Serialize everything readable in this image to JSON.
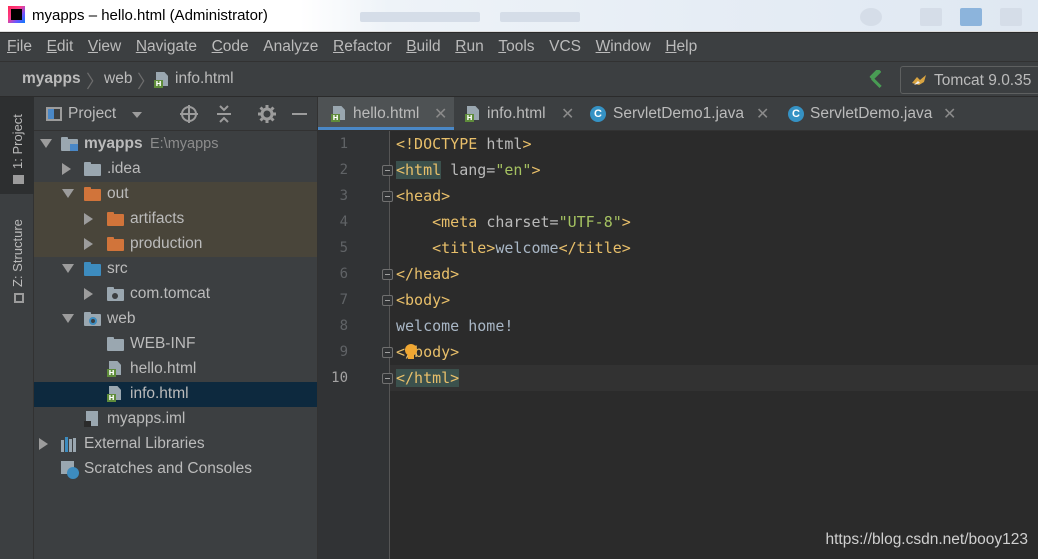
{
  "window": {
    "title": "myapps – hello.html (Administrator)"
  },
  "menu": [
    {
      "label": "File",
      "mnemonic": "F",
      "rest": "ile"
    },
    {
      "label": "Edit",
      "mnemonic": "E",
      "rest": "dit"
    },
    {
      "label": "View",
      "mnemonic": "V",
      "rest": "iew"
    },
    {
      "label": "Navigate",
      "mnemonic": "N",
      "rest": "avigate"
    },
    {
      "label": "Code",
      "mnemonic": "C",
      "rest": "ode"
    },
    {
      "label": "Analyze",
      "mnemonic": "",
      "rest": "Analyze"
    },
    {
      "label": "Refactor",
      "mnemonic": "R",
      "rest": "efactor"
    },
    {
      "label": "Build",
      "mnemonic": "B",
      "rest": "uild"
    },
    {
      "label": "Run",
      "mnemonic": "R",
      "rest": "un"
    },
    {
      "label": "Tools",
      "mnemonic": "T",
      "rest": "ools"
    },
    {
      "label": "VCS",
      "mnemonic": "",
      "rest": "VCS"
    },
    {
      "label": "Window",
      "mnemonic": "W",
      "rest": "indow"
    },
    {
      "label": "Help",
      "mnemonic": "H",
      "rest": "elp"
    }
  ],
  "breadcrumb": {
    "project": "myapps",
    "folder": "web",
    "file": "info.html"
  },
  "run_config": {
    "label": "Tomcat 9.0.35"
  },
  "side_tabs": {
    "project": "1: Project",
    "structure": "Z: Structure"
  },
  "project_panel": {
    "title": "Project",
    "tree": [
      {
        "label": "myapps",
        "path": "E:\\myapps",
        "icon": "module-folder-icon",
        "expanded": true
      },
      {
        "label": ".idea",
        "icon": "folder-icon",
        "expanded": false
      },
      {
        "label": "out",
        "icon": "excluded-folder-icon",
        "expanded": true
      },
      {
        "label": "artifacts",
        "icon": "excluded-folder-icon",
        "expanded": false
      },
      {
        "label": "production",
        "icon": "excluded-folder-icon",
        "expanded": false
      },
      {
        "label": "src",
        "icon": "source-folder-icon",
        "expanded": true
      },
      {
        "label": "com.tomcat",
        "icon": "package-folder-icon",
        "expanded": false
      },
      {
        "label": "web",
        "icon": "web-folder-icon",
        "expanded": true
      },
      {
        "label": "WEB-INF",
        "icon": "folder-icon"
      },
      {
        "label": "hello.html",
        "icon": "html-file-icon"
      },
      {
        "label": "info.html",
        "icon": "html-file-icon",
        "selected": true
      },
      {
        "label": "myapps.iml",
        "icon": "iml-file-icon"
      },
      {
        "label": "External Libraries",
        "icon": "libraries-icon",
        "expanded": false
      },
      {
        "label": "Scratches and Consoles",
        "icon": "scratches-icon"
      }
    ]
  },
  "tabs": [
    {
      "label": "hello.html",
      "icon": "html-file-icon",
      "active": true
    },
    {
      "label": "info.html",
      "icon": "html-file-icon",
      "active": false
    },
    {
      "label": "ServletDemo1.java",
      "icon": "class-icon",
      "active": false
    },
    {
      "label": "ServletDemo.java",
      "icon": "class-icon",
      "active": false
    }
  ],
  "editor": {
    "current_line": 10,
    "lines": [
      {
        "n": "1",
        "tokens": [
          [
            "t-tag",
            "<!DOCTYPE "
          ],
          [
            "t-attr",
            "html"
          ],
          [
            "t-tag",
            ">"
          ]
        ]
      },
      {
        "n": "2",
        "tokens": [
          [
            "t-tag",
            "<html "
          ],
          [
            "t-attr",
            "lang="
          ],
          [
            "t-val",
            "\"en\""
          ],
          [
            "t-tag",
            ">"
          ]
        ]
      },
      {
        "n": "3",
        "tokens": [
          [
            "t-tag",
            "<head>"
          ]
        ]
      },
      {
        "n": "4",
        "tokens": [
          [
            "t-text",
            "    "
          ],
          [
            "t-tag",
            "<meta "
          ],
          [
            "t-attr",
            "charset="
          ],
          [
            "t-val",
            "\"UTF-8\""
          ],
          [
            "t-tag",
            ">"
          ]
        ]
      },
      {
        "n": "5",
        "tokens": [
          [
            "t-text",
            "    "
          ],
          [
            "t-tag",
            "<title>"
          ],
          [
            "t-text",
            "welcome"
          ],
          [
            "t-tag",
            "</title>"
          ]
        ]
      },
      {
        "n": "6",
        "tokens": [
          [
            "t-tag",
            "</head>"
          ]
        ]
      },
      {
        "n": "7",
        "tokens": [
          [
            "t-tag",
            "<body>"
          ]
        ]
      },
      {
        "n": "8",
        "tokens": [
          [
            "t-text",
            "welcome home!"
          ]
        ]
      },
      {
        "n": "9",
        "tokens": [
          [
            "t-tag",
            "</body>"
          ]
        ]
      },
      {
        "n": "10",
        "tokens": [
          [
            "t-tag",
            "</html>"
          ]
        ]
      }
    ]
  },
  "watermark": "https://blog.csdn.net/booy123",
  "colors": {
    "tag": "#e8bf6a",
    "attr": "#bababa",
    "value": "#a5c261",
    "text": "#a9b7c6",
    "selection": "#0d293e",
    "accent": "#4a88c7"
  }
}
